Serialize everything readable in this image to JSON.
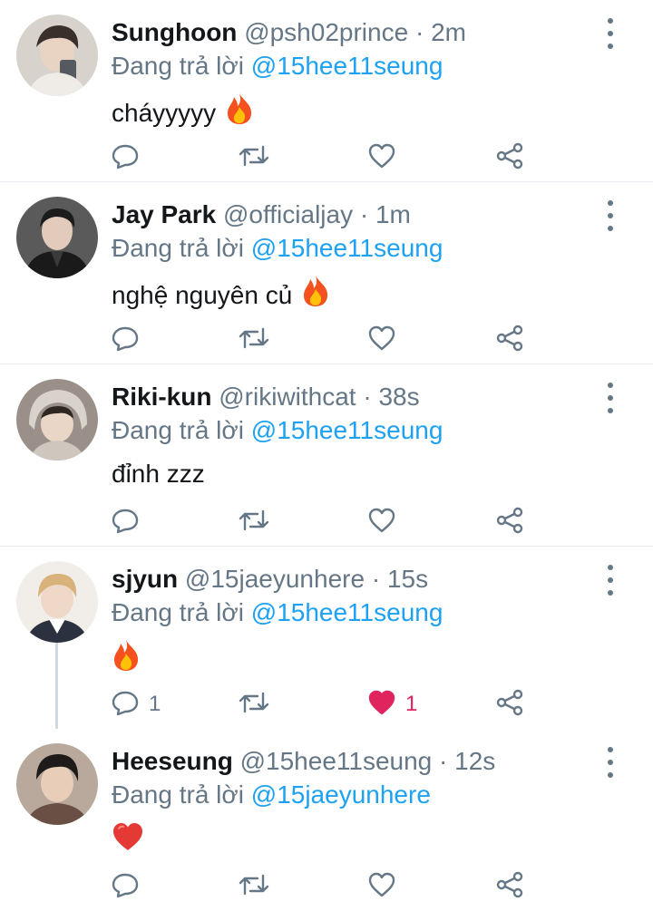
{
  "colors": {
    "link": "#1da1f2",
    "muted": "#657786",
    "like": "#e0245e",
    "divider": "#e6ecf0"
  },
  "tweets": [
    {
      "name": "Sunghoon",
      "handle": "@psh02prince",
      "dot": "·",
      "time": "2m",
      "reply_prefix": "Đang trả lời",
      "reply_to": "@15hee11seung",
      "text": "cháyyyyy",
      "emoji_icon": "fire-emoji-icon",
      "reply_count": "",
      "like_count": "",
      "liked": false
    },
    {
      "name": "Jay Park",
      "handle": "@officialjay",
      "dot": "·",
      "time": "1m",
      "reply_prefix": "Đang trả lời",
      "reply_to": "@15hee11seung",
      "text": "nghệ nguyên củ",
      "emoji_icon": "fire-emoji-icon",
      "reply_count": "",
      "like_count": "",
      "liked": false
    },
    {
      "name": "Riki-kun",
      "handle": "@rikiwithcat",
      "dot": "·",
      "time": "38s",
      "reply_prefix": "Đang trả lời",
      "reply_to": "@15hee11seung",
      "text": "đỉnh zzz",
      "emoji_icon": "",
      "reply_count": "",
      "like_count": "",
      "liked": false
    },
    {
      "name": "sjyun",
      "handle": "@15jaeyunhere",
      "dot": "·",
      "time": "15s",
      "reply_prefix": "Đang trả lời",
      "reply_to": "@15hee11seung",
      "text": "",
      "emoji_icon": "fire-emoji-icon",
      "reply_count": "1",
      "like_count": "1",
      "liked": true
    },
    {
      "name": "Heeseung",
      "handle": "@15hee11seung",
      "dot": "·",
      "time": "12s",
      "reply_prefix": "Đang trả lời",
      "reply_to": "@15jaeyunhere",
      "text": "",
      "emoji_icon": "red-heart-emoji-icon",
      "reply_count": "",
      "like_count": "",
      "liked": false
    }
  ]
}
